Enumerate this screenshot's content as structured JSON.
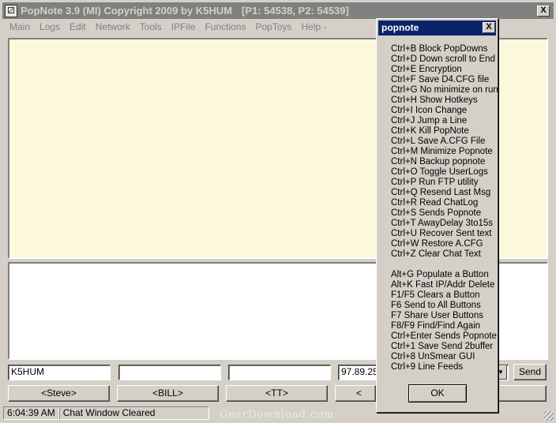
{
  "window": {
    "title": "PopNote 3.9 (MI) Copyright 2009 by K5HUM",
    "ports": "[P1: 54538, P2: 54539]",
    "close_label": "X"
  },
  "menu": [
    "Main",
    "Logs",
    "Edit",
    "Network",
    "Tools",
    "IPFile",
    "Functions",
    "PopToys",
    "Help -"
  ],
  "fields": {
    "callsign_value": "K5HUM",
    "field2_value": "",
    "field3_value": "",
    "ip_value": "97.89.25"
  },
  "send_label": "Send",
  "buttons": [
    "<Steve>",
    "<BILL>",
    "<TT>",
    "<"
  ],
  "status": {
    "time": "6:04:39 AM",
    "message": "Chat Window Cleared"
  },
  "watermark": "GearDownload.com",
  "popup": {
    "title": "popnote",
    "close_label": "X",
    "ctrl_hotkeys": [
      "Ctrl+B  Block PopDowns",
      "Ctrl+D  Down scroll to End",
      "Ctrl+E  Encryption",
      "Ctrl+F  Save D4.CFG file",
      "Ctrl+G  No minimize on run",
      "Ctrl+H  Show Hotkeys",
      "Ctrl+I  Icon Change",
      "Ctrl+J  Jump a Line",
      "Ctrl+K  Kill PopNote",
      "Ctrl+L  Save A.CFG File",
      "Ctrl+M  Minimize Popnote",
      "Ctrl+N  Backup popnote",
      "Ctrl+O  Toggle UserLogs",
      "Ctrl+P  Run FTP utility",
      "Ctrl+Q  Resend Last Msg",
      "Ctrl+R  Read ChatLog",
      "Ctrl+S  Sends Popnote",
      "Ctrl+T  AwayDelay 3to15s",
      "Ctrl+U  Recover Sent text",
      "Ctrl+W  Restore A.CFG",
      "Ctrl+Z  Clear Chat Text"
    ],
    "other_hotkeys": [
      "Alt+G  Populate a Button",
      "Alt+K  Fast IP/Addr Delete",
      "F1/F5  Clears a Button",
      "F6  Send to All Buttons",
      "F7  Share User Buttons",
      "F8/F9  Find/Find Again",
      "Ctrl+Enter  Sends Popnote",
      "Ctrl+1  Save Send 2buffer",
      "Ctrl+8  UnSmear GUI",
      "Ctrl+9  Line Feeds"
    ],
    "ok_label": "OK"
  }
}
